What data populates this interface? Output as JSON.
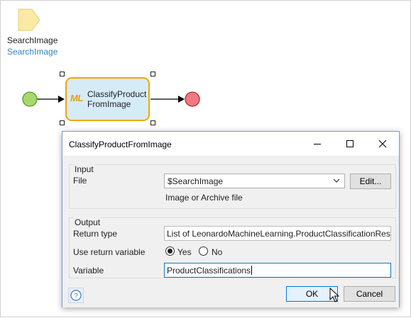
{
  "canvas": {
    "parameter": {
      "name": "SearchImage",
      "type": "SearchImage"
    },
    "activity": {
      "badge": "ML",
      "label_line1": "ClassifyProduct",
      "label_line2": "FromImage"
    }
  },
  "dialog": {
    "title": "ClassifyProductFromImage",
    "input_group": {
      "title": "Input",
      "file_label": "File",
      "file_value": "$SearchImage",
      "edit_label": "Edit...",
      "file_hint": "Image or Archive file"
    },
    "output_group": {
      "title": "Output",
      "return_type_label": "Return type",
      "return_type_value": "List of LeonardoMachineLearning.ProductClassificationResponse",
      "use_return_label": "Use return variable",
      "yes_label": "Yes",
      "no_label": "No",
      "use_return_selected": "Yes",
      "variable_label": "Variable",
      "variable_value": "ProductClassifications"
    },
    "ok_label": "OK",
    "cancel_label": "Cancel"
  },
  "colors": {
    "start_event": "#a6d86b",
    "end_event": "#f07a80",
    "activity_fill": "#d6ebf8",
    "activity_border": "#f0a800",
    "parameter": "#fbe9a6",
    "link": "#2e86c1",
    "focus": "#0078d7"
  }
}
